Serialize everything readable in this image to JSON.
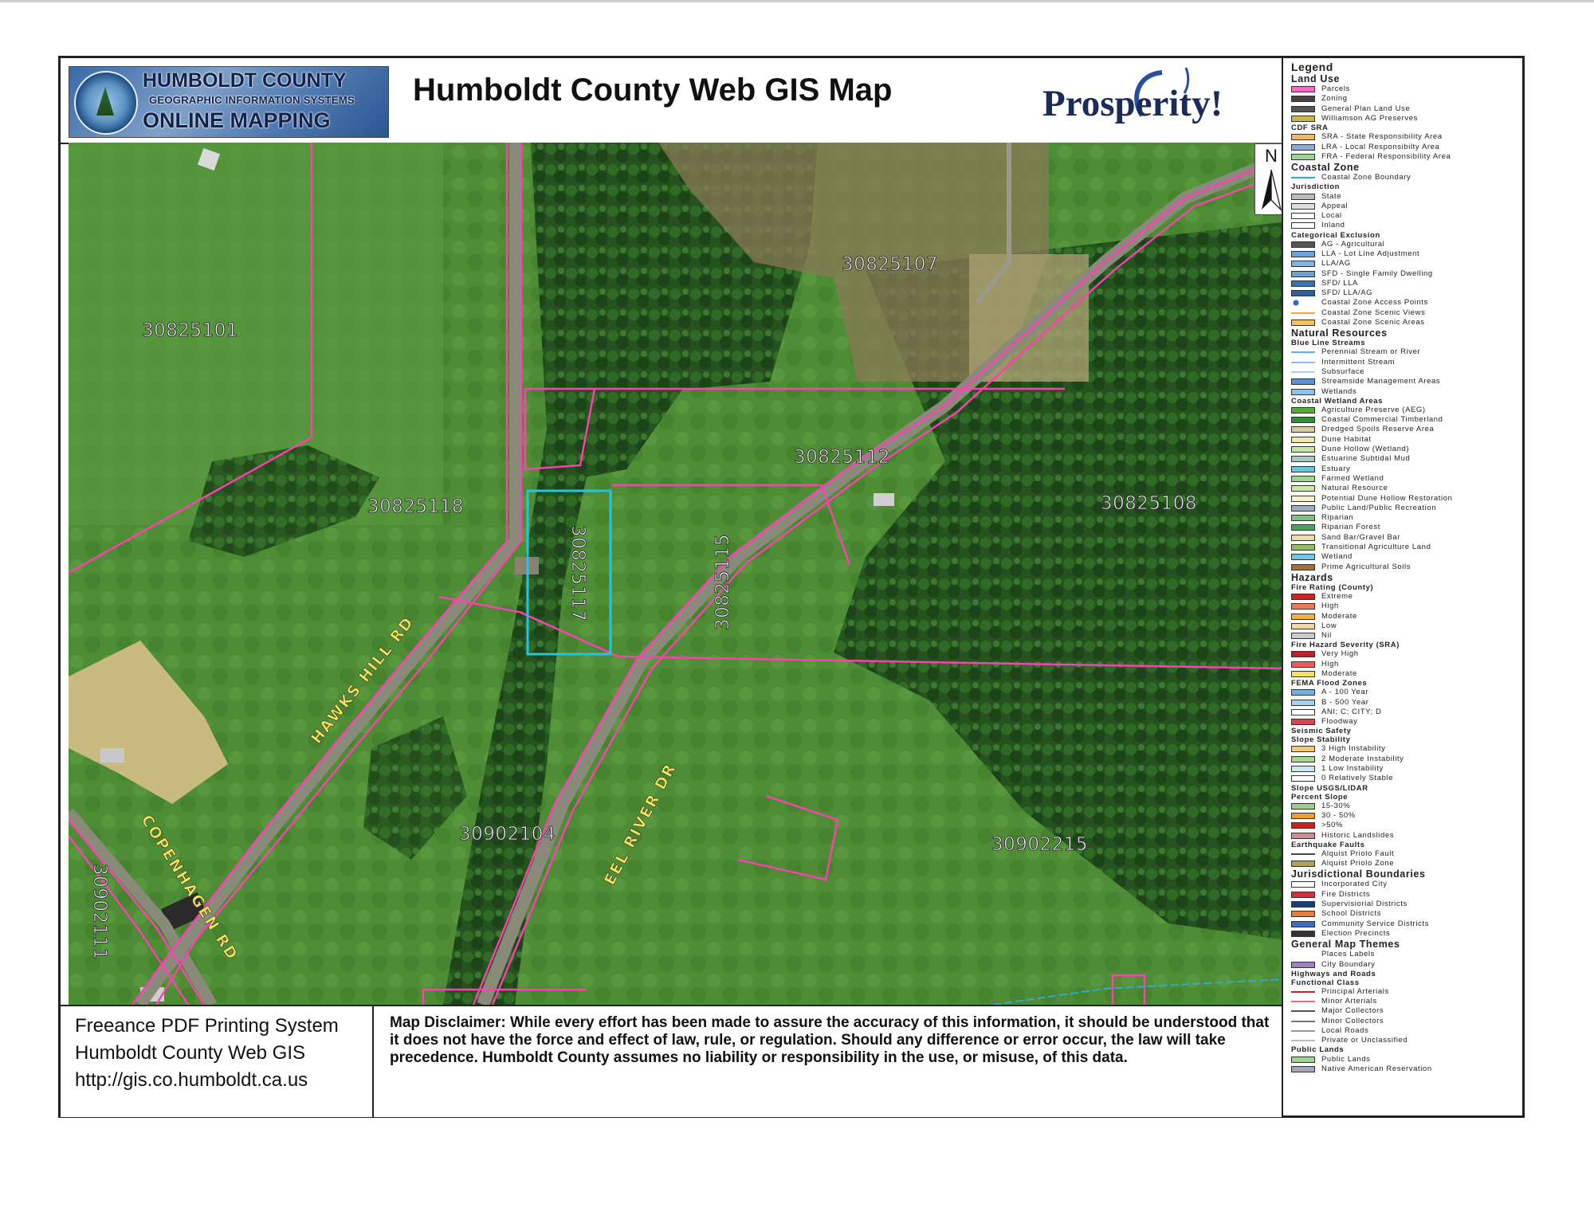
{
  "header": {
    "logo": {
      "line1": "HUMBOLDT COUNTY",
      "line2": "GEOGRAPHIC INFORMATION SYSTEMS",
      "line3": "ONLINE MAPPING"
    },
    "title": "Humboldt County Web GIS Map",
    "brand": "Prosperity!"
  },
  "map": {
    "north_label": "N",
    "parcels": [
      {
        "id": "30825101"
      },
      {
        "id": "30825107"
      },
      {
        "id": "30825112"
      },
      {
        "id": "30825108"
      },
      {
        "id": "30825118"
      },
      {
        "id": "30825117"
      },
      {
        "id": "30825115"
      },
      {
        "id": "30902104"
      },
      {
        "id": "30902215"
      },
      {
        "id": "30902111"
      }
    ],
    "roads": [
      "HAWKS HILL RD",
      "COPENHAGEN RD",
      "EEL RIVER DR"
    ]
  },
  "legend": {
    "title": "Legend",
    "sections": [
      {
        "head": "Land Use",
        "items": [
          {
            "label": "Parcels",
            "color": "#ff66cc",
            "kind": "box"
          },
          {
            "label": "Zoning",
            "color": "#444444",
            "kind": "box"
          },
          {
            "label": "General Plan Land Use",
            "color": "#555555",
            "kind": "box"
          },
          {
            "label": "Williamson AG Preserves",
            "color": "#c9b84a",
            "kind": "box"
          }
        ]
      },
      {
        "sub": "CDF SRA",
        "items": [
          {
            "label": "SRA -  State Responsibility Area",
            "color": "#f2b86a",
            "kind": "box"
          },
          {
            "label": "LRA -  Local Responsibilty Area",
            "color": "#8fa9d6",
            "kind": "box"
          },
          {
            "label": "FRA -  Federal Responsibility Area",
            "color": "#9ed69a",
            "kind": "box"
          }
        ]
      },
      {
        "head": "Coastal Zone",
        "items": [
          {
            "label": "Coastal Zone Boundary",
            "color": "#33aacc",
            "kind": "line"
          }
        ]
      },
      {
        "sub": "Jurisdiction",
        "items": [
          {
            "label": "State",
            "color": "#bbbbbb",
            "kind": "box"
          },
          {
            "label": "Appeal",
            "color": "#dddddd",
            "kind": "box"
          },
          {
            "label": "Local",
            "color": "#ffffff",
            "kind": "box"
          },
          {
            "label": "Inland",
            "color": "#ffffff",
            "kind": "box"
          }
        ]
      },
      {
        "sub": "Categorical Exclusion",
        "items": [
          {
            "label": "AG - Agricultural",
            "color": "#555555",
            "kind": "box"
          },
          {
            "label": "LLA -  Lot Line Adjustment",
            "color": "#66a6e0",
            "kind": "box"
          },
          {
            "label": "LLA/AG",
            "color": "#7fb3e3",
            "kind": "box"
          },
          {
            "label": "SFD -  Single Family Dwelling",
            "color": "#6fa0d0",
            "kind": "box"
          },
          {
            "label": "SFD/ LLA",
            "color": "#3a6fb0",
            "kind": "box"
          },
          {
            "label": "SFD/ LLA/AG",
            "color": "#2f5f9f",
            "kind": "box"
          },
          {
            "label": "Coastal Zone Access Points",
            "color": "#3366cc",
            "kind": "dot"
          },
          {
            "label": "Coastal Zone Scenic Views",
            "color": "#f2a93b",
            "kind": "line"
          },
          {
            "label": "Coastal Zone Scenic Areas",
            "color": "#f6c25a",
            "kind": "box"
          }
        ]
      },
      {
        "head": "Natural Resources",
        "items": []
      },
      {
        "sub": "Blue Line Streams",
        "items": [
          {
            "label": "Perennial Stream or River",
            "color": "#66aaff",
            "kind": "line"
          },
          {
            "label": "Intermittent Stream",
            "color": "#88bbff",
            "kind": "line"
          },
          {
            "label": "Subsurface",
            "color": "#aaccff",
            "kind": "line"
          },
          {
            "label": "Streamside Management Areas",
            "color": "#5b8fd6",
            "kind": "box"
          },
          {
            "label": "Wetlands",
            "color": "#8fc3e6",
            "kind": "box"
          }
        ]
      },
      {
        "sub": "Coastal Wetland Areas",
        "items": [
          {
            "label": "Agriculture Preserve (AEG)",
            "color": "#5aa83a",
            "kind": "box"
          },
          {
            "label": "Coastal Commercial Timberland",
            "color": "#2f8f3a",
            "kind": "box"
          },
          {
            "label": "Dredged Spoils Reserve Area",
            "color": "#d9c9a0",
            "kind": "box"
          },
          {
            "label": "Dune Habitat",
            "color": "#f0e6a8",
            "kind": "box"
          },
          {
            "label": "Dune Hollow (Wetland)",
            "color": "#c8e6a0",
            "kind": "box"
          },
          {
            "label": "Estuarine Subtidal  Mud",
            "color": "#a9c9c0",
            "kind": "box"
          },
          {
            "label": "Estuary",
            "color": "#66c6e0",
            "kind": "box"
          },
          {
            "label": "Farmed Wetland",
            "color": "#9fd68f",
            "kind": "box"
          },
          {
            "label": "Natural Resource",
            "color": "#cde8a8",
            "kind": "box"
          },
          {
            "label": "Potential Dune Hollow Restoration",
            "color": "#f6f0c8",
            "kind": "box"
          },
          {
            "label": "Public Land/Public Recreation",
            "color": "#9ab0c0",
            "kind": "box"
          },
          {
            "label": "Riparian",
            "color": "#7fbf7f",
            "kind": "box"
          },
          {
            "label": "Riparian Forest",
            "color": "#4f9f5f",
            "kind": "box"
          },
          {
            "label": "Sand Bar/Gravel Bar",
            "color": "#e8dcb0",
            "kind": "box"
          },
          {
            "label": "Transitional Agriculture Land",
            "color": "#8fbf5f",
            "kind": "box"
          },
          {
            "label": "Wetland",
            "color": "#6fc6e6",
            "kind": "box"
          },
          {
            "label": "Prime Agricultural Soils",
            "color": "#a0703a",
            "kind": "box"
          }
        ]
      },
      {
        "head": "Hazards",
        "items": []
      },
      {
        "sub": "Fire Rating (County)",
        "items": [
          {
            "label": "Extreme",
            "color": "#d42020",
            "kind": "box"
          },
          {
            "label": "High",
            "color": "#f07a50",
            "kind": "box"
          },
          {
            "label": "Moderate",
            "color": "#f6b040",
            "kind": "box"
          },
          {
            "label": "Low",
            "color": "#f6d6a0",
            "kind": "box"
          },
          {
            "label": "Nil",
            "color": "#cccccc",
            "kind": "box"
          }
        ]
      },
      {
        "sub": "Fire Hazard Severity (SRA)",
        "items": [
          {
            "label": "Very High",
            "color": "#c0202a",
            "kind": "box"
          },
          {
            "label": "High",
            "color": "#f05a5a",
            "kind": "box"
          },
          {
            "label": "Moderate",
            "color": "#f6e060",
            "kind": "box"
          }
        ]
      },
      {
        "sub": "FEMA Flood Zones",
        "items": [
          {
            "label": "A - 100 Year",
            "color": "#6fb0e6",
            "kind": "box"
          },
          {
            "label": "B - 500 Year",
            "color": "#a6d0f0",
            "kind": "box"
          },
          {
            "label": "ANI; C; CITY; D",
            "color": "#ffffff",
            "kind": "box"
          },
          {
            "label": "Floodway",
            "color": "#e04050",
            "kind": "box"
          }
        ]
      },
      {
        "sub": "Seismic Safety",
        "items": []
      },
      {
        "sub": "Slope Stability",
        "items": [
          {
            "label": "3  High Instability",
            "color": "#f6c870",
            "kind": "box"
          },
          {
            "label": "2  Moderate Instability",
            "color": "#a6d68f",
            "kind": "box"
          },
          {
            "label": "1  Low Instability",
            "color": "#d0e8f0",
            "kind": "box"
          },
          {
            "label": "0  Relatively Stable",
            "color": "#ffffff",
            "kind": "box"
          }
        ]
      },
      {
        "sub": "Slope USGS/LIDAR",
        "items": []
      },
      {
        "sub": "Percent Slope",
        "items": [
          {
            "label": "15-30%",
            "color": "#9fcf8f",
            "kind": "box"
          },
          {
            "label": "30 - 50%",
            "color": "#f0a030",
            "kind": "box"
          },
          {
            "label": ">50%",
            "color": "#d02020",
            "kind": "box"
          },
          {
            "label": "Historic Landslides",
            "color": "#c89090",
            "kind": "box"
          }
        ]
      },
      {
        "sub": "Earthquake Faults",
        "items": [
          {
            "label": "Alquist Priolo Fault",
            "color": "#444444",
            "kind": "line"
          },
          {
            "label": "Alquist Priolo Zone",
            "color": "#b0a060",
            "kind": "box"
          }
        ]
      },
      {
        "head": "Jurisdictional Boundaries",
        "items": [
          {
            "label": "Incorporated City",
            "color": "#ffffff",
            "kind": "box"
          },
          {
            "label": "Fire Districts",
            "color": "#d03040",
            "kind": "box"
          },
          {
            "label": "Supervisiorial Districts",
            "color": "#203a80",
            "kind": "box"
          },
          {
            "label": "School Districts",
            "color": "#e08040",
            "kind": "box"
          },
          {
            "label": "Community Service Districts",
            "color": "#3a70c0",
            "kind": "box"
          },
          {
            "label": "Election Precincts",
            "color": "#333333",
            "kind": "box"
          }
        ]
      },
      {
        "head": "General Map Themes",
        "items": [
          {
            "label": "Places Labels",
            "color": "#ffffff",
            "kind": "none"
          },
          {
            "label": "City Boundary",
            "color": "#a080c0",
            "kind": "box"
          }
        ]
      },
      {
        "sub": "Highways and Roads",
        "items": []
      },
      {
        "sub": "Functional Class",
        "items": [
          {
            "label": "Principal Arterials",
            "color": "#d02020",
            "kind": "line"
          },
          {
            "label": "Minor Arterials",
            "color": "#e07070",
            "kind": "line"
          },
          {
            "label": "Major Collectors",
            "color": "#555555",
            "kind": "line"
          },
          {
            "label": "Minor Collectors",
            "color": "#777777",
            "kind": "line"
          },
          {
            "label": "Local Roads",
            "color": "#999999",
            "kind": "line"
          },
          {
            "label": "Private or Unclassified",
            "color": "#bbbbbb",
            "kind": "line"
          }
        ]
      },
      {
        "sub": "Public Lands",
        "items": [
          {
            "label": "Public Lands",
            "color": "#9fd68f",
            "kind": "box"
          },
          {
            "label": "Native American Reservation",
            "color": "#a0a8b8",
            "kind": "box"
          }
        ]
      }
    ]
  },
  "footer": {
    "system_line1": "Freeance PDF Printing System",
    "system_line2": "Humboldt County Web GIS",
    "system_line3": "http://gis.co.humboldt.ca.us",
    "disclaimer": "Map Disclaimer:  While every effort has been made to assure the accuracy of this information, it should be understood that it does not have the force and effect of law, rule, or regulation.  Should any difference or error occur, the law will take precedence.  Humboldt County assumes no liability or responsibility in the use, or misuse, of this data."
  }
}
